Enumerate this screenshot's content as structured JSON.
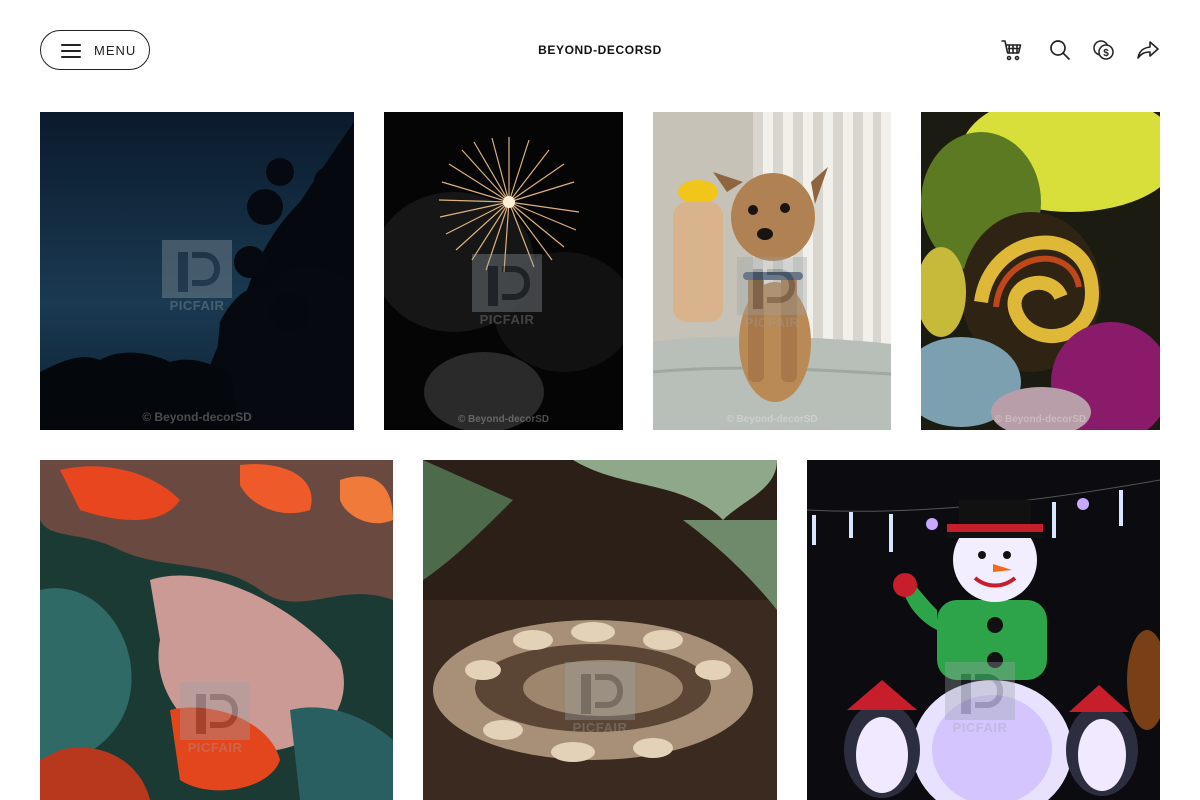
{
  "header": {
    "menu_label": "MENU",
    "brand": "BEYOND-DECORSD",
    "icons": [
      "cart-icon",
      "search-icon",
      "currency-icon",
      "share-icon"
    ]
  },
  "gallery": {
    "watermark_logo_text": "PICFAIR",
    "photos": [
      {
        "subject": "night-sky-trees",
        "credit": "© Beyond-decorSD"
      },
      {
        "subject": "fireworks",
        "credit": "© Beyond-decorSD"
      },
      {
        "subject": "yorkie-dog",
        "credit": "© Beyond-decorSD"
      },
      {
        "subject": "abstract-swirl",
        "credit": "© Beyond-decorSD"
      },
      {
        "subject": "abstract-coral-teal",
        "credit": ""
      },
      {
        "subject": "ball-python",
        "credit": ""
      },
      {
        "subject": "inflatable-snowman-penguins",
        "credit": ""
      }
    ]
  }
}
